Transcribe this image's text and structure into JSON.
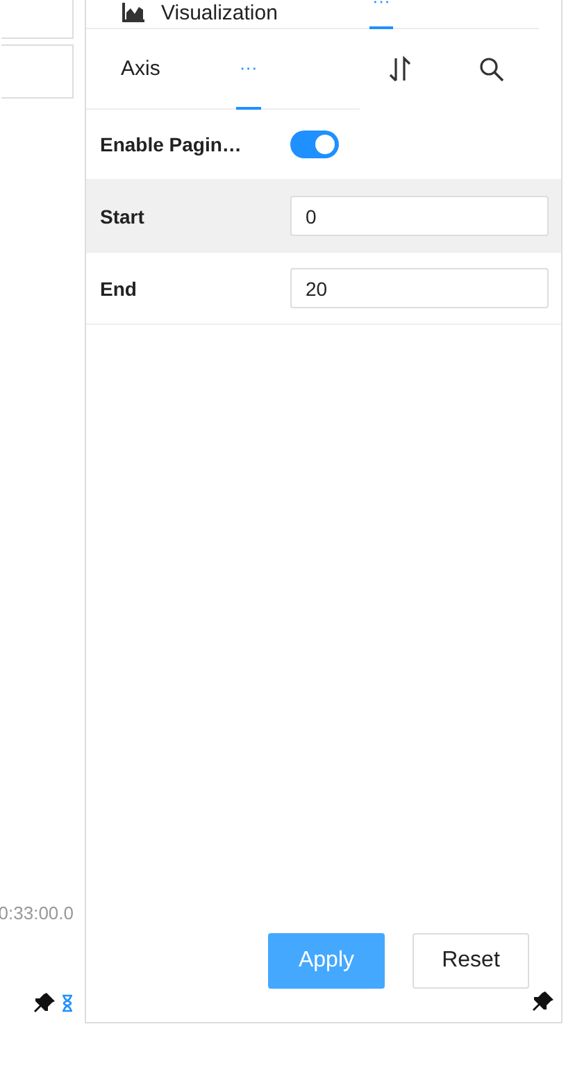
{
  "left_pane": {
    "time": "0:33:00.0"
  },
  "top_tabs": [
    {
      "kind": "icon-label",
      "label": "Visualization",
      "selected": false
    },
    {
      "kind": "dots",
      "label": "···",
      "selected": true
    }
  ],
  "sub_tabs": [
    {
      "label": "Axis",
      "selected": false
    },
    {
      "label": "···",
      "selected": true
    }
  ],
  "settings": [
    {
      "kind": "toggle",
      "label": "Enable Pagin…",
      "on": true,
      "highlighted": false
    },
    {
      "kind": "input",
      "label": "Start",
      "value": "0",
      "highlighted": true
    },
    {
      "kind": "input",
      "label": "End",
      "value": "20",
      "highlighted": false
    }
  ],
  "buttons": [
    {
      "label": "Apply",
      "primary": true
    },
    {
      "label": "Reset",
      "primary": false
    }
  ]
}
